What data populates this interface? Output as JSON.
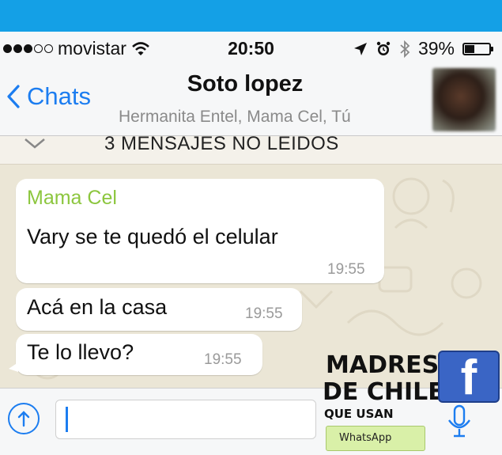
{
  "status_bar": {
    "carrier": "movistar",
    "time": "20:50",
    "battery": "39%",
    "battery_level": 0.39
  },
  "header": {
    "back_label": "Chats",
    "title": "Soto lopez",
    "subtitle": "Hermanita Entel, Mama Cel, Tú"
  },
  "unread_banner": "3 MENSAJES NO LEIDOS",
  "messages": [
    {
      "sender": "Mama Cel",
      "text": "Vary se te quedó el celular",
      "time": "19:55"
    },
    {
      "text": "Acá en la casa",
      "time": "19:55"
    },
    {
      "text": "Te lo llevo?",
      "time": "19:55"
    }
  ],
  "watermark": {
    "line1": "MADRES",
    "line2": "DE CHILE",
    "line3": "QUE USAN",
    "badge": "WhatsApp",
    "fb_letter": "f"
  },
  "colors": {
    "accent": "#1c7df0",
    "sender_name": "#8cc63e",
    "top_band": "#14a0e6"
  }
}
